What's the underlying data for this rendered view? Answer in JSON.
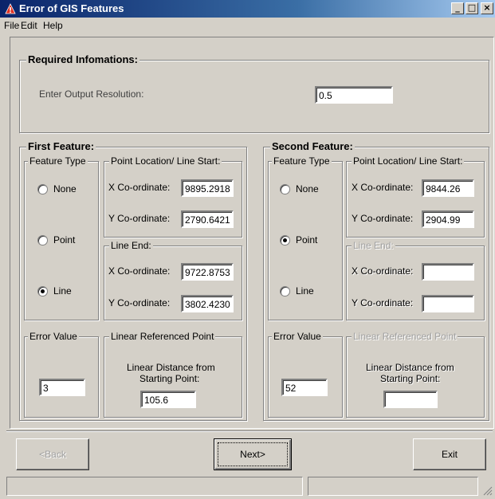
{
  "window": {
    "title": "Error of GIS Features",
    "min_glyph": "_",
    "max_glyph": "□",
    "close_glyph": "×"
  },
  "menu": [
    "File",
    "Edit",
    "Help"
  ],
  "required": {
    "legend": "Required Infomations:",
    "resolution_label": "Enter Output Resolution:",
    "resolution_value": "0.5"
  },
  "first": {
    "legend": "First Feature:",
    "feature_type_legend": "Feature Type",
    "options": [
      "None",
      "Point",
      "Line"
    ],
    "selected": "Line",
    "point_legend": "Point Location/ Line Start:",
    "x_label": "X Co-ordinate:",
    "x_value": "9895.2918",
    "y_label": "Y Co-ordinate:",
    "y_value": "2790.6421",
    "line_end_legend": "Line End:",
    "end_x_label": "X Co-ordinate:",
    "end_x_value": "9722.8753",
    "end_y_label": "Y Co-ordinate:",
    "end_y_value": "3802.4230",
    "error_legend": "Error Value",
    "error_value": "3",
    "lrp_legend": "Linear Referenced Point",
    "lrp_label_1": "Linear Distance from",
    "lrp_label_2": "Starting Point:",
    "lrp_value": "105.6"
  },
  "second": {
    "legend": "Second Feature:",
    "feature_type_legend": "Feature Type",
    "options": [
      "None",
      "Point",
      "Line"
    ],
    "selected": "Point",
    "point_legend": "Point Location/ Line Start:",
    "x_label": "X Co-ordinate:",
    "x_value": "9844.26",
    "y_label": "Y Co-ordinate:",
    "y_value": "2904.99",
    "line_end_legend": "Line End:",
    "end_x_label": "X Co-ordinate:",
    "end_x_value": "",
    "end_y_label": "Y Co-ordinate:",
    "end_y_value": "",
    "error_legend": "Error Value",
    "error_value": "52",
    "lrp_legend": "Linear Referenced Point",
    "lrp_label_1": "Linear Distance from",
    "lrp_label_2": "Starting Point:",
    "lrp_value": ""
  },
  "buttons": {
    "back": "<Back",
    "next": "Next>",
    "exit": "Exit"
  },
  "colors": {
    "face": "#d4d0c8",
    "title_start": "#0a246a",
    "disabled_text": "#a0a0a0"
  }
}
